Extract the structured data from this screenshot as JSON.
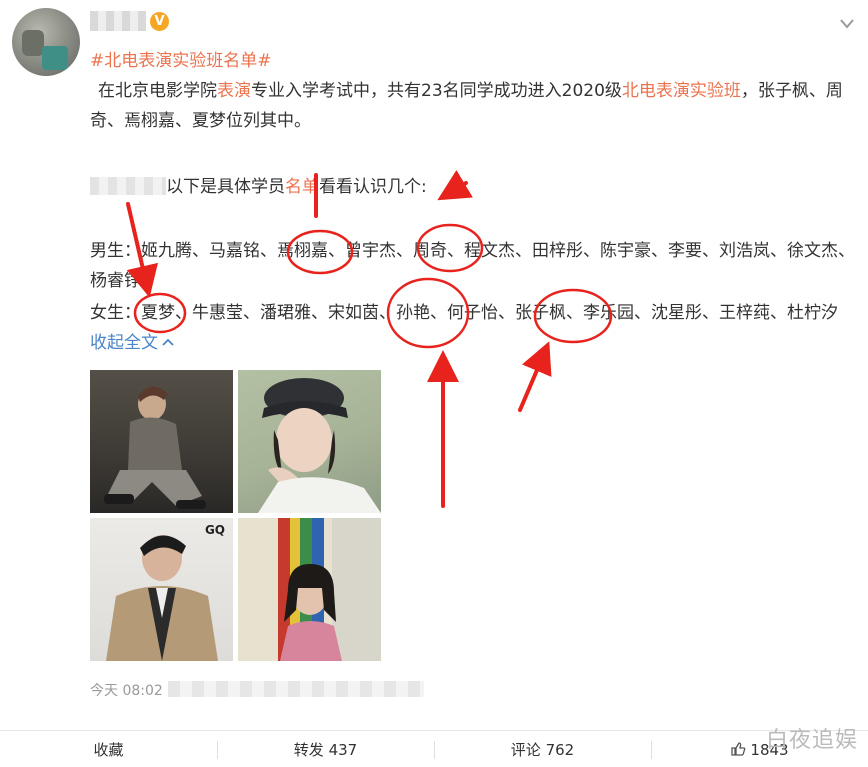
{
  "post": {
    "hashtag": "#北电表演实验班名单#",
    "intro": {
      "a": "在北京电影学院",
      "b": "表演",
      "c": "专业入学考试中，共有23名同学成功进入2020级",
      "d": "北电表演实验班",
      "e": "，张子枫、周奇、焉栩嘉、夏梦位列其中。"
    },
    "list_intro": {
      "a": "以下是具体学员",
      "b": "名单",
      "c": "看看认识几个:"
    },
    "male": "男生：姬九腾、马嘉铭、焉栩嘉、曾宇杰、周奇、程文杰、田梓彤、陈宇豪、李要、刘浩岚、徐文杰、杨睿铮",
    "female": "女生：夏梦、牛惠莹、潘珺雅、宋如茵、孙艳、何子怡、张子枫、李乐园、沈星彤、王梓莼、杜柠汐",
    "collapse_label": "收起全文",
    "photo_badge": "GQ",
    "time": "今天 08:02"
  },
  "footer": {
    "favorite": "收藏",
    "repost": "转发 437",
    "comment": "评论 762",
    "like": "1843"
  },
  "watermark": "白夜追娱",
  "colors": {
    "highlight": "#eb7350",
    "link": "#4b84c6",
    "annotation": "#e8231d",
    "badge": "#f5a623"
  }
}
